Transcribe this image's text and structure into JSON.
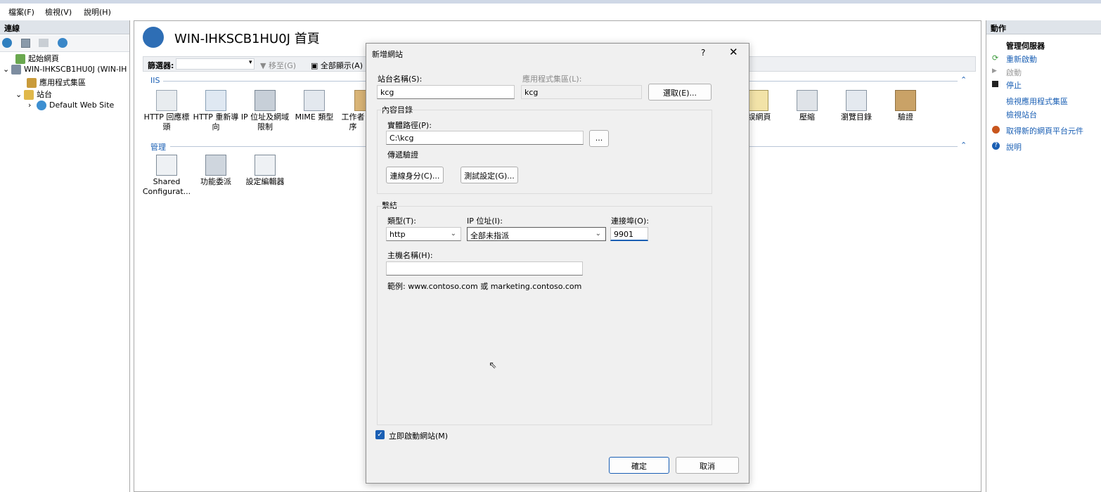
{
  "menubar": {
    "file": "檔案(F)",
    "view": "檢視(V)",
    "help": "說明(H)"
  },
  "connections": {
    "title": "連線",
    "tree": {
      "start_page": "起始網頁",
      "server": "WIN-IHKSCB1HU0J (WIN-IH",
      "app_pools": "應用程式集區",
      "sites": "站台",
      "default_site": "Default Web Site"
    }
  },
  "main": {
    "title": "WIN-IHKSCB1HU0J 首頁",
    "filter_label": "篩選器:",
    "goto": "移至(G)",
    "show_all": "全部顯示(A)",
    "sections": {
      "iis": "IIS",
      "manage": "管理"
    },
    "iis_features": [
      {
        "label": "HTTP 回應標頭"
      },
      {
        "label": "HTTP 重新導向"
      },
      {
        "label": "IP 位址及網域限制"
      },
      {
        "label": "MIME 類型"
      },
      {
        "label": "工作者序"
      }
    ],
    "iis_features_right": [
      {
        "label": "誤網頁"
      },
      {
        "label": "壓縮"
      },
      {
        "label": "瀏覽目錄"
      },
      {
        "label": "驗證"
      }
    ],
    "manage_features": [
      {
        "label": "Shared Configurat..."
      },
      {
        "label": "功能委派"
      },
      {
        "label": "設定編輯器"
      }
    ]
  },
  "actions": {
    "title": "動作",
    "manage_server": "管理伺服器",
    "restart": "重新啟動",
    "start": "啟動",
    "stop": "停止",
    "view_app_pools": "檢視應用程式集區",
    "view_sites": "檢視站台",
    "get_components": "取得新的網頁平台元件",
    "help": "說明"
  },
  "dialog": {
    "title": "新增網站",
    "help_btn": "?",
    "site_name_label": "站台名稱(S):",
    "site_name_value": "kcg",
    "app_pool_label": "應用程式集區(L):",
    "app_pool_value": "kcg",
    "select_button": "選取(E)...",
    "content_dir_label": "內容目錄",
    "physical_path_label": "實體路徑(P):",
    "physical_path_value": "C:\\kcg",
    "browse_button": "...",
    "passthrough_label": "傳遞驗證",
    "connect_as_button": "連線身分(C)...",
    "test_settings_button": "測試設定(G)...",
    "binding_label": "繫結",
    "type_label": "類型(T):",
    "type_value": "http",
    "ip_label": "IP 位址(I):",
    "ip_value": "全部未指派",
    "port_label": "連接埠(O):",
    "port_value": "9901",
    "hostname_label": "主機名稱(H):",
    "hostname_value": "",
    "example_text": "範例: www.contoso.com 或 marketing.contoso.com",
    "start_immediately_label": "立即啟動網站(M)",
    "start_immediately_checked": true,
    "ok_button": "確定",
    "cancel_button": "取消"
  }
}
